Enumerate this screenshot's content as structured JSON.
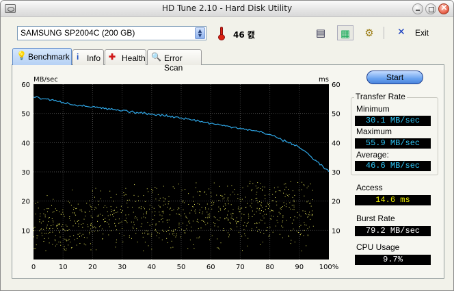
{
  "window": {
    "title": "HD Tune 2.10 - Hard Disk Utility"
  },
  "toolbar": {
    "drive": "SAMSUNG SP2004C (200 GB)",
    "temperature": "46 캜",
    "exit_label": "Exit",
    "icons": [
      "copy-icon",
      "save-icon",
      "options-icon",
      "exit-icon"
    ]
  },
  "tabs": [
    {
      "label": "Benchmark",
      "icon": "lightbulb-icon",
      "active": true
    },
    {
      "label": "Info",
      "icon": "info-icon",
      "active": false
    },
    {
      "label": "Health",
      "icon": "health-cross-icon",
      "active": false
    },
    {
      "label": "Error Scan",
      "icon": "magnifier-icon",
      "active": false
    }
  ],
  "side": {
    "start_label": "Start",
    "transfer_rate_title": "Transfer Rate",
    "minimum_label": "Minimum",
    "minimum_value": "30.1 MB/sec",
    "maximum_label": "Maximum",
    "maximum_value": "55.9 MB/sec",
    "average_label": "Average:",
    "average_value": "46.6 MB/sec",
    "access_label": "Access",
    "access_value": "14.6 ms",
    "burst_label": "Burst Rate",
    "burst_value": "79.2 MB/sec",
    "cpu_label": "CPU Usage",
    "cpu_value": "9.7%"
  },
  "chart_data": {
    "type": "line",
    "xlabel": "",
    "left_unit": "MB/sec",
    "right_unit": "ms",
    "x_ticks": [
      "0",
      "10",
      "20",
      "30",
      "40",
      "50",
      "60",
      "70",
      "80",
      "90",
      "100%"
    ],
    "y_ticks": [
      "0",
      "10",
      "20",
      "30",
      "40",
      "50",
      "60"
    ],
    "xlim": [
      0,
      100
    ],
    "ylim": [
      0,
      60
    ],
    "y2lim": [
      0,
      60
    ],
    "grid": true,
    "background": "#000000",
    "transfer_color": "#2fa8e8",
    "access_color": "#e8e85a",
    "series": [
      {
        "name": "Transfer Rate",
        "x": [
          0,
          2,
          4,
          6,
          8,
          10,
          12,
          14,
          16,
          18,
          20,
          22,
          24,
          26,
          28,
          30,
          32,
          34,
          36,
          38,
          40,
          42,
          44,
          46,
          48,
          50,
          52,
          54,
          56,
          58,
          60,
          62,
          64,
          66,
          68,
          70,
          72,
          74,
          76,
          78,
          80,
          82,
          84,
          86,
          88,
          90,
          92,
          94,
          96,
          98,
          100
        ],
        "y": [
          55.6,
          55.3,
          55.0,
          54.6,
          54.1,
          53.8,
          53.4,
          53.0,
          52.7,
          52.4,
          52.3,
          51.9,
          51.6,
          51.4,
          51.1,
          50.9,
          50.6,
          50.4,
          50.2,
          50.0,
          49.8,
          49.6,
          49.3,
          49.1,
          48.8,
          48.5,
          48.1,
          47.8,
          47.4,
          47.0,
          46.6,
          46.3,
          45.8,
          45.6,
          45.3,
          45.0,
          44.6,
          44.1,
          43.8,
          43.3,
          42.8,
          42.0,
          41.0,
          40.2,
          39.4,
          38.3,
          37.0,
          35.2,
          33.5,
          31.8,
          30.1
        ]
      }
    ]
  }
}
